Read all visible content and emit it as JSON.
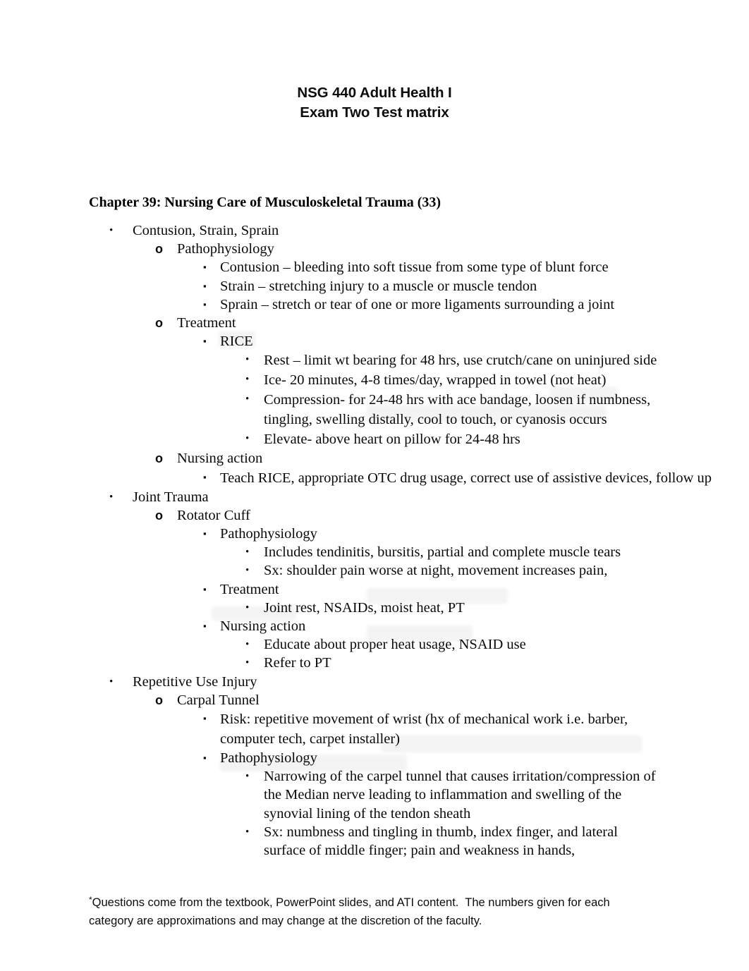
{
  "document": {
    "title_lines": [
      "NSG 440 Adult Health I",
      "Exam Two Test matrix"
    ],
    "chapter_heading": "Chapter 39: Nursing Care of Musculoskeletal Trauma (33)",
    "outline": [
      {
        "level": 1,
        "marker": "•",
        "text": "Contusion, Strain, Sprain"
      },
      {
        "level": 2,
        "marker": "o",
        "text": "Pathophysiology"
      },
      {
        "level": 3,
        "marker": "▪",
        "text": "Contusion – bleeding into soft tissue from some type of blunt force"
      },
      {
        "level": 3,
        "marker": "▪",
        "text": "Strain – stretching injury to a muscle or muscle tendon"
      },
      {
        "level": 3,
        "marker": "▪",
        "text": "Sprain – stretch or tear of one or more ligaments surrounding a joint"
      },
      {
        "level": 2,
        "marker": "o",
        "text": "Treatment"
      },
      {
        "level": 3,
        "marker": "▪",
        "text": "RICE"
      },
      {
        "level": 4,
        "marker": "•",
        "text": "Rest – limit wt bearing for 48 hrs, use crutch/cane on uninjured side"
      },
      {
        "level": 4,
        "marker": "•",
        "text": "Ice- 20 minutes, 4-8 times/day, wrapped in towel (not heat)"
      },
      {
        "level": 4,
        "marker": "•",
        "text": "Compression- for 24-48 hrs with ace bandage, loosen if numbness, tingling, swelling distally, cool to touch, or cyanosis occurs"
      },
      {
        "level": 4,
        "marker": "•",
        "text": "Elevate- above heart on pillow for 24-48 hrs"
      },
      {
        "level": 2,
        "marker": "o",
        "text": "Nursing action"
      },
      {
        "level": 3,
        "marker": "▪",
        "text": "Teach RICE, appropriate OTC drug usage, correct use of assistive devices, follow up"
      },
      {
        "level": 1,
        "marker": "•",
        "text": "Joint Trauma"
      },
      {
        "level": 2,
        "marker": "o",
        "text": "Rotator Cuff"
      },
      {
        "level": 3,
        "marker": "▪",
        "text": "Pathophysiology"
      },
      {
        "level": 4,
        "marker": "•",
        "text": "Includes tendinitis, bursitis, partial and complete muscle tears"
      },
      {
        "level": 4,
        "marker": "•",
        "text": "Sx: shoulder pain worse at night, movement increases pain,"
      },
      {
        "level": 3,
        "marker": "▪",
        "text": "Treatment"
      },
      {
        "level": 4,
        "marker": "•",
        "text": "Joint rest, NSAIDs, moist heat, PT"
      },
      {
        "level": 3,
        "marker": "▪",
        "text": "Nursing action"
      },
      {
        "level": 4,
        "marker": "•",
        "text": "Educate about proper heat usage, NSAID use"
      },
      {
        "level": 4,
        "marker": "•",
        "text": "Refer to PT"
      },
      {
        "level": 1,
        "marker": "•",
        "text": "Repetitive Use Injury"
      },
      {
        "level": 2,
        "marker": "o",
        "text": "Carpal Tunnel"
      },
      {
        "level": 3,
        "marker": "▪",
        "text": "Risk: repetitive movement of wrist (hx of mechanical work i.e. barber, computer tech, carpet installer)"
      },
      {
        "level": 3,
        "marker": "▪",
        "text": "Pathophysiology"
      },
      {
        "level": 4,
        "marker": "•",
        "text": "Narrowing of the carpel tunnel that causes irritation/compression of the Median nerve leading to inflammation and swelling of the synovial lining of the tendon sheath"
      },
      {
        "level": 4,
        "marker": "•",
        "text": "Sx: numbness and tingling in thumb, index finger, and lateral surface of middle finger; pain and weakness in hands,"
      }
    ],
    "footer": {
      "asterisk": "*",
      "text": "Questions come from the textbook, PowerPoint slides, and ATI content.  The numbers given for each category are approximations and may change at the discretion of the faculty."
    }
  }
}
